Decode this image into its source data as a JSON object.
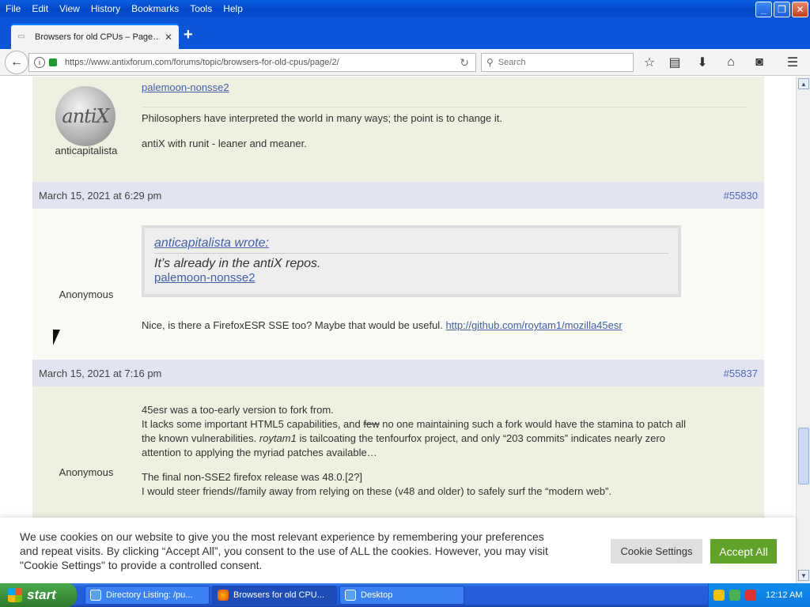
{
  "menubar": {
    "items": [
      "File",
      "Edit",
      "View",
      "History",
      "Bookmarks",
      "Tools",
      "Help"
    ],
    "underline_letters": [
      "F",
      "E",
      "V",
      "s",
      "B",
      "T",
      "H"
    ]
  },
  "tab": {
    "title": "Browsers for old CPUs – Page…",
    "close": "✕",
    "new_tab": "+"
  },
  "navbar": {
    "url": "https://www.antixforum.com/forums/topic/browsers-for-old-cpus/page/2/",
    "search_placeholder": "Search",
    "icons": [
      "back-icon",
      "info-icon",
      "lock-icon",
      "reload-icon",
      "star-icon",
      "reading-list-icon",
      "download-icon",
      "home-icon",
      "pocket-icon",
      "menu-icon"
    ]
  },
  "posts": {
    "p1": {
      "top_link": "palemoon-nonsse2",
      "author": "anticapitalista",
      "avatar_text": "antiX",
      "sig1": "Philosophers have interpreted the world in many ways; the point is to change it.",
      "sig2": "antiX with runit - leaner and meaner."
    },
    "p2": {
      "date": "March 15, 2021 at 6:29 pm",
      "id": "#55830",
      "author": "Anonymous",
      "quote_head": "anticapitalista wrote:",
      "quote_body": "It’s already in the antiX repos.",
      "quote_link": "palemoon-nonsse2",
      "text": "Nice, is there a FirefoxESR SSE too? Maybe that would be useful.",
      "link": "http://github.com/roytam1/mozilla45esr"
    },
    "p3": {
      "date": "March 15, 2021 at 7:16 pm",
      "id": "#55837",
      "author": "Anonymous",
      "l1": "45esr was a too-early version to fork from.",
      "l2a": "It lacks some important HTML5 capabilities, and",
      "l2strike": "few",
      "l2b": "no one maintaining such a fork would have the stamina to patch all",
      "l3a": "the known vulnerabilities.",
      "l3em": "roytam1",
      "l3b": "is tailcoating the tenfourfox project, and only “203 commits” indicates nearly zero",
      "l4": "attention to applying the myriad patches available…",
      "l5": "The final non-SSE2 firefox release was 48.0.[2?]",
      "l6": "I would steer friends//family away from relying on these (v48 and older) to safely surf the “modern web”."
    }
  },
  "cookie": {
    "text": "We use cookies on our website to give you the most relevant experience by remembering your preferences and repeat visits. By clicking “Accept All”, you consent to the use of ALL the cookies. However, you may visit \"Cookie Settings\" to provide a controlled consent.",
    "settings_label": "Cookie Settings",
    "accept_label": "Accept All"
  },
  "taskbar": {
    "start": "start",
    "items": [
      "Directory Listing: /pu...",
      "Browsers for old CPU...",
      "Desktop"
    ],
    "clock": "12:12 AM"
  },
  "colors": {
    "accent_link": "#4060a8",
    "post_bg": "#f0f0e1",
    "meta_bg": "#e3e4f1",
    "accept_green": "#61a229"
  }
}
